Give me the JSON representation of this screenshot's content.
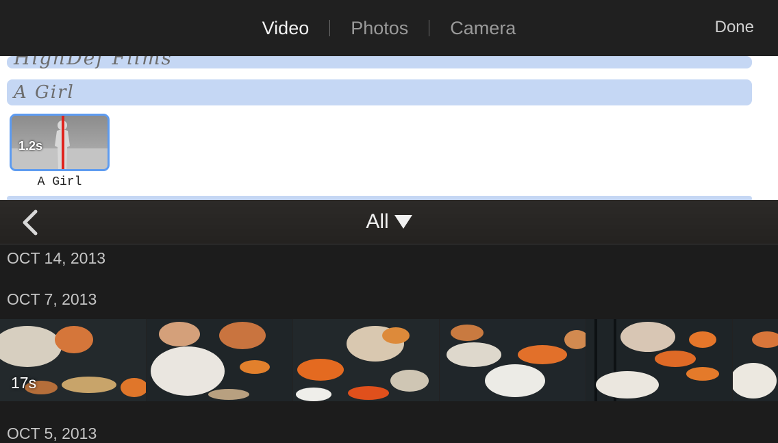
{
  "topbar": {
    "tabs": [
      {
        "label": "Video",
        "active": true
      },
      {
        "label": "Photos",
        "active": false
      },
      {
        "label": "Camera",
        "active": false
      }
    ],
    "done_label": "Done"
  },
  "storyboard": {
    "title_text": "HighDef Films",
    "subtitle_text": "A Girl",
    "clip": {
      "duration": "1.2s",
      "name": "A Girl"
    }
  },
  "browser": {
    "filter_label": "All",
    "icons": {
      "back": "chevron-left-icon",
      "filter": "triangle-down-icon"
    },
    "dates": [
      "OCT 14, 2013",
      "OCT 7, 2013",
      "OCT 5, 2013"
    ],
    "clip_duration": "17s"
  },
  "colors": {
    "accent_blue": "#5d9bf0",
    "playhead_red": "#e0231d",
    "stripe_blue": "#c5d7f4"
  }
}
